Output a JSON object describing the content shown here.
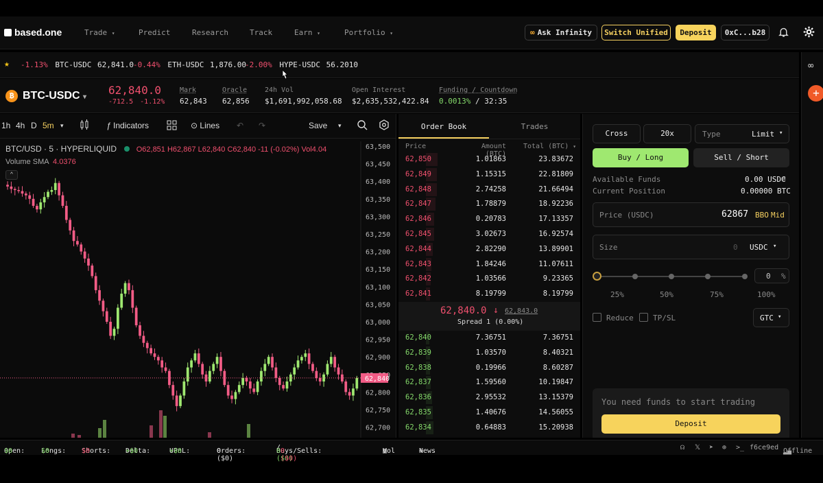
{
  "nav": {
    "logo": "based.one",
    "items": [
      "Trade",
      "Predict",
      "Research",
      "Track",
      "Earn",
      "Portfolio"
    ],
    "ask": "Ask Infinity",
    "switch": "Switch Unified",
    "deposit": "Deposit",
    "wallet": "0xC...b28"
  },
  "ticker": [
    {
      "chg": "-1.13%",
      "pair": "BTC-USDC",
      "price": "62,841.0"
    },
    {
      "chg": "-0.44%",
      "pair": "ETH-USDC",
      "price": "1,876.00"
    },
    {
      "chg": "-2.00%",
      "pair": "HYPE-USDC",
      "price": "56.2010"
    }
  ],
  "market": {
    "pair": "BTC-USDC",
    "price": "62,840.0",
    "change": "-712.5",
    "change_pct": "-1.12%",
    "mark_label": "Mark",
    "mark": "62,843",
    "oracle_label": "Oracle",
    "oracle": "62,856",
    "vol_label": "24h Vol",
    "vol": "$1,691,992,058.68",
    "oi_label": "Open Interest",
    "oi": "$2,635,532,422.84",
    "funding_label": "Funding / Countdown",
    "funding": "0.0013%",
    "countdown": "32:35"
  },
  "chart": {
    "timeframes": [
      "1h",
      "4h",
      "D",
      "5m"
    ],
    "indicators": "Indicators",
    "lines": "Lines",
    "save": "Save",
    "symbol": "BTC/USD · 5 · HYPERLIQUID",
    "ohlc": {
      "o": "O62,851",
      "h": "H62,867",
      "l": "L62,840",
      "c": "C62,840",
      "chg": "-11 (-0.02%)",
      "vol": "Vol4.04"
    },
    "volume_label": "Volume SMA",
    "volume_val": "4.0376",
    "price_tag": "62,840",
    "yticks": [
      "63,500",
      "63,450",
      "63,400",
      "63,350",
      "63,300",
      "63,250",
      "63,200",
      "63,150",
      "63,100",
      "63,050",
      "63,000",
      "62,950",
      "62,900",
      "62,850",
      "62,800",
      "62,750",
      "62,700"
    ],
    "colors": {
      "up": "#9fe870",
      "down": "#f25c86"
    }
  },
  "orderbook": {
    "tab_book": "Order Book",
    "tab_trades": "Trades",
    "col_price": "Price",
    "col_amount": "Amount (BTC)",
    "col_total": "Total (BTC)",
    "asks": [
      [
        "62,850",
        "1.01863",
        "23.83672"
      ],
      [
        "62,849",
        "1.15315",
        "22.81809"
      ],
      [
        "62,848",
        "2.74258",
        "21.66494"
      ],
      [
        "62,847",
        "1.78879",
        "18.92236"
      ],
      [
        "62,846",
        "0.20783",
        "17.13357"
      ],
      [
        "62,845",
        "3.02673",
        "16.92574"
      ],
      [
        "62,844",
        "2.82290",
        "13.89901"
      ],
      [
        "62,843",
        "1.84246",
        "11.07611"
      ],
      [
        "62,842",
        "1.03566",
        "9.23365"
      ],
      [
        "62,841",
        "8.19799",
        "8.19799"
      ]
    ],
    "mid_price": "62,840.0",
    "mid_arrow": "↓",
    "mid_mark": "62,843.0",
    "spread": "Spread 1 (0.00%)",
    "bids": [
      [
        "62,840",
        "7.36751",
        "7.36751"
      ],
      [
        "62,839",
        "1.03570",
        "8.40321"
      ],
      [
        "62,838",
        "0.19966",
        "8.60287"
      ],
      [
        "62,837",
        "1.59560",
        "10.19847"
      ],
      [
        "62,836",
        "2.95532",
        "13.15379"
      ],
      [
        "62,835",
        "1.40676",
        "14.56055"
      ],
      [
        "62,834",
        "0.64883",
        "15.20938"
      ]
    ]
  },
  "trade": {
    "cross": "Cross",
    "leverage": "20x",
    "type_label": "Type",
    "type_val": "Limit",
    "buy": "Buy / Long",
    "sell": "Sell / Short",
    "avail_label": "Available Funds",
    "avail_val": "0.00 USDC",
    "pos_label": "Current Position",
    "pos_val": "0.00000 BTC",
    "price_label": "Price (USDC)",
    "price_val": "62867",
    "bbo": "BBO",
    "mid": "Mid",
    "size_label": "Size",
    "size_val": "0",
    "size_unit": "USDC",
    "pct_val": "0",
    "pct_unit": "%",
    "marks": [
      "25%",
      "50%",
      "75%",
      "100%"
    ],
    "reduce": "Reduce",
    "tpsl": "TP/SL",
    "tif": "GTC",
    "funds_msg": "You need funds to start trading",
    "deposit": "Deposit"
  },
  "status": {
    "open_label": "Open:",
    "open": "$0",
    "longs_label": "Longs:",
    "longs": "$0",
    "shorts_label": "Shorts:",
    "shorts": "$0",
    "delta_label": "Delta:",
    "delta": "+$0",
    "upnl_label": "UPnL:",
    "upnl": "+$0",
    "orders_label": "Orders:",
    "orders": "0 ($0)",
    "bs_label": "Buys/Sells:",
    "buys": "0 ($0)",
    "sells": "0 ($0)",
    "vol": "Vol",
    "news": "News",
    "hash": "f6ce9ed",
    "offline": "Offline"
  }
}
